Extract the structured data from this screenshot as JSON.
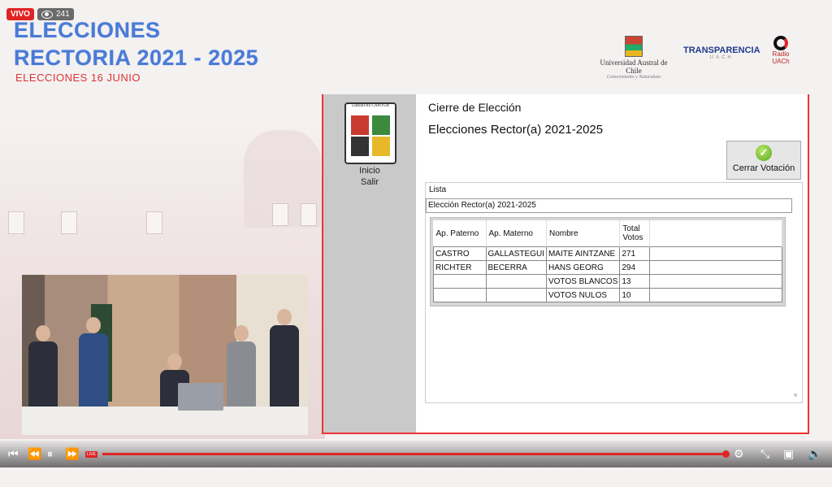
{
  "stream": {
    "live_label": "VIVO",
    "viewers": "241",
    "live_tag": "LIVE"
  },
  "header": {
    "title_line1": "ELECCIONES",
    "title_line2": "RECTORIA 2021 - 2025",
    "subtitle": "ELECCIONES 16 JUNIO"
  },
  "logos": {
    "uach_name": "Universidad Austral de Chile",
    "uach_motto": "Conocimiento y Naturaleza",
    "transparencia": "TRANSPARENCIA",
    "transparencia_sub": "UACH",
    "radio": "Radio",
    "radio_sub": "UACh"
  },
  "app": {
    "crest_text_top": "LIBERTAS CAPITUR",
    "sidebar": {
      "inicio": "Inicio",
      "salir": "Salir"
    },
    "heading": "Cierre de Elección",
    "election_title": "Elecciones Rector(a) 2021-2025",
    "close_button": "Cerrar Votación",
    "panel_label": "Lista",
    "dropdown_value": "Elección Rector(a) 2021-2025",
    "table": {
      "headers": [
        "Ap. Paterno",
        "Ap. Materno",
        "Nombre",
        "Total Votos"
      ],
      "rows": [
        [
          "CASTRO",
          "GALLASTEGUI",
          "MAITE AINTZANE",
          "271"
        ],
        [
          "RICHTER",
          "BECERRA",
          "HANS GEORG",
          "294"
        ],
        [
          "",
          "",
          "VOTOS BLANCOS",
          "13"
        ],
        [
          "",
          "",
          "VOTOS NULOS",
          "10"
        ]
      ]
    }
  },
  "colors": {
    "title_blue": "#4a7bd6",
    "accent_red": "#e02424"
  }
}
